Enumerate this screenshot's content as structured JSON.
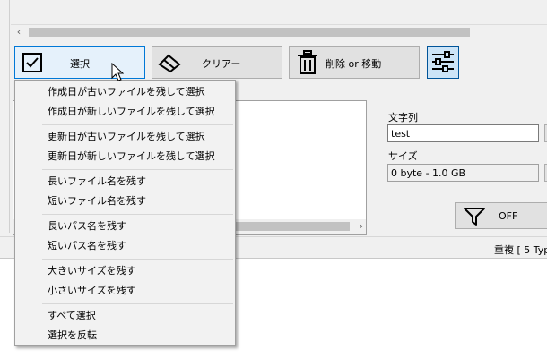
{
  "toolbar": {
    "select_label": "選択",
    "clear_label": "クリアー",
    "move_label": "削除 or 移動"
  },
  "filter": {
    "string_label": "文字列",
    "string_value": "test",
    "size_label": "サイズ",
    "size_value": "0 byte - 1.0 GB",
    "off_label": "OFF"
  },
  "statusbar": {
    "text": "重複 [ 5 Typ"
  },
  "menu": {
    "items": [
      "作成日が古いファイルを残して選択",
      "作成日が新しいファイルを残して選択",
      "更新日が古いファイルを残して選択",
      "更新日が新しいファイルを残して選択",
      "長いファイル名を残す",
      "短いファイル名を残す",
      "長いパス名を残す",
      "短いパス名を残す",
      "大きいサイズを残す",
      "小さいサイズを残す",
      "すべて選択",
      "選択を反転"
    ]
  },
  "icons": {
    "select": "checkbox-icon",
    "clear": "eraser-icon",
    "move": "trash-icon",
    "filter_settings": "sliders-icon",
    "filter_toggle": "funnel-icon"
  },
  "colors": {
    "accent_border": "#0078d7",
    "active_button": "#e5f1fb",
    "toggle_button": "#cce4f7"
  }
}
